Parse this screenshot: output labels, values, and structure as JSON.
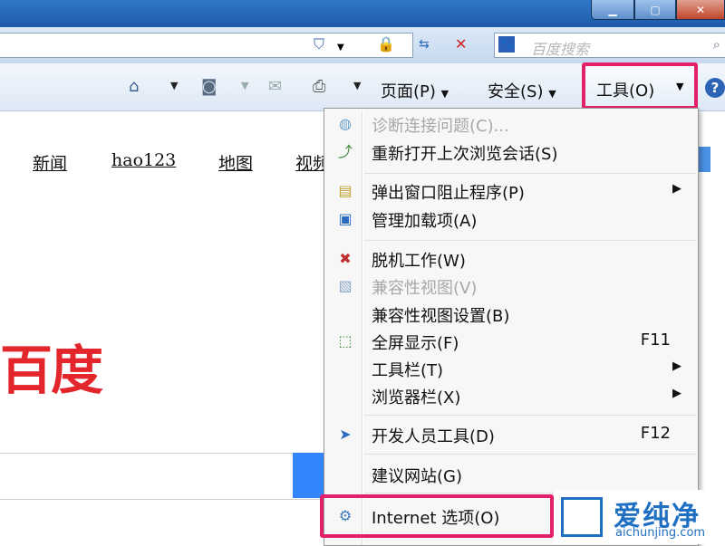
{
  "toolbar": {
    "page_label": "页面(P)",
    "safety_label": "安全(S)",
    "tools_label": "工具(O)",
    "help_label": "?"
  },
  "search": {
    "placeholder": "百度搜索"
  },
  "page": {
    "nav_links": [
      "新闻",
      "hao123",
      "地图",
      "视频"
    ],
    "logo_text": "百度"
  },
  "tools_menu": {
    "items": [
      {
        "label": "诊断连接问题(C)...",
        "disabled": true,
        "icon": "globe-icon"
      },
      {
        "label": "重新打开上次浏览会话(S)",
        "disabled": false,
        "icon": "reopen-icon"
      },
      {
        "label": "弹出窗口阻止程序(P)",
        "disabled": false,
        "icon": "popup-icon",
        "submenu": true
      },
      {
        "label": "管理加载项(A)",
        "disabled": false,
        "icon": "addons-icon"
      },
      {
        "label": "脱机工作(W)",
        "disabled": false,
        "icon": "offline-icon"
      },
      {
        "label": "兼容性视图(V)",
        "disabled": true,
        "icon": "compat-icon"
      },
      {
        "label": "兼容性视图设置(B)",
        "disabled": false
      },
      {
        "label": "全屏显示(F)",
        "disabled": false,
        "icon": "fullscreen-icon",
        "shortcut": "F11"
      },
      {
        "label": "工具栏(T)",
        "disabled": false,
        "submenu": true
      },
      {
        "label": "浏览器栏(X)",
        "disabled": false,
        "submenu": true
      },
      {
        "label": "开发人员工具(D)",
        "disabled": false,
        "icon": "devtools-icon",
        "shortcut": "F12"
      },
      {
        "label": "建议网站(G)",
        "disabled": false
      },
      {
        "label": "Internet 选项(O)",
        "disabled": false,
        "icon": "options-icon"
      }
    ]
  },
  "watermark": {
    "title": "爱纯净",
    "url": "aichunjing.com"
  },
  "colors": {
    "highlight": "#e3206a",
    "baidu_red": "#e3262b",
    "accent_blue": "#1f6fc2"
  }
}
